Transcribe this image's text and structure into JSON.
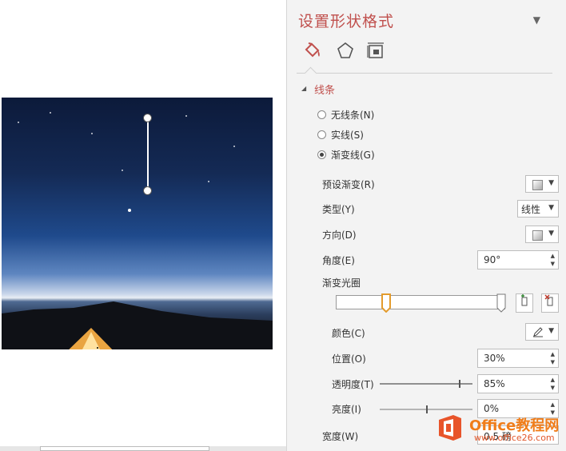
{
  "pane": {
    "title": "设置形状格式",
    "close_glyph": "▼",
    "tabs": [
      {
        "icon": "paint-bucket-icon",
        "selected": true
      },
      {
        "icon": "pentagon-icon",
        "selected": false
      },
      {
        "icon": "size-layout-icon",
        "selected": false
      }
    ],
    "section": {
      "title": "线条",
      "expanded": true,
      "options": [
        {
          "label": "无线条(N)",
          "checked": false
        },
        {
          "label": "实线(S)",
          "checked": false
        },
        {
          "label": "渐变线(G)",
          "checked": true
        }
      ]
    },
    "props": {
      "preset_label": "预设渐变(R)",
      "type_label": "类型(Y)",
      "type_value": "线性",
      "direction_label": "方向(D)",
      "angle_label": "角度(E)",
      "angle_value": "90°",
      "stops_label": "渐变光圈",
      "color_label": "颜色(C)",
      "position_label": "位置(O)",
      "position_value": "30%",
      "transparency_label": "透明度(T)",
      "transparency_value": "85%",
      "transparency_level": 0.85,
      "brightness_label": "亮度(I)",
      "brightness_value": "0%",
      "brightness_level": 0.5,
      "width_label": "宽度(W)",
      "width_value": "0.5 磅"
    },
    "gradient_stops_positions": [
      0.3,
      1.0
    ]
  },
  "watermark": {
    "title": "Office教程网",
    "url": "www.office26.com"
  },
  "colors": {
    "accent": "#c0504d",
    "pane_bg": "#f3f3f3"
  }
}
